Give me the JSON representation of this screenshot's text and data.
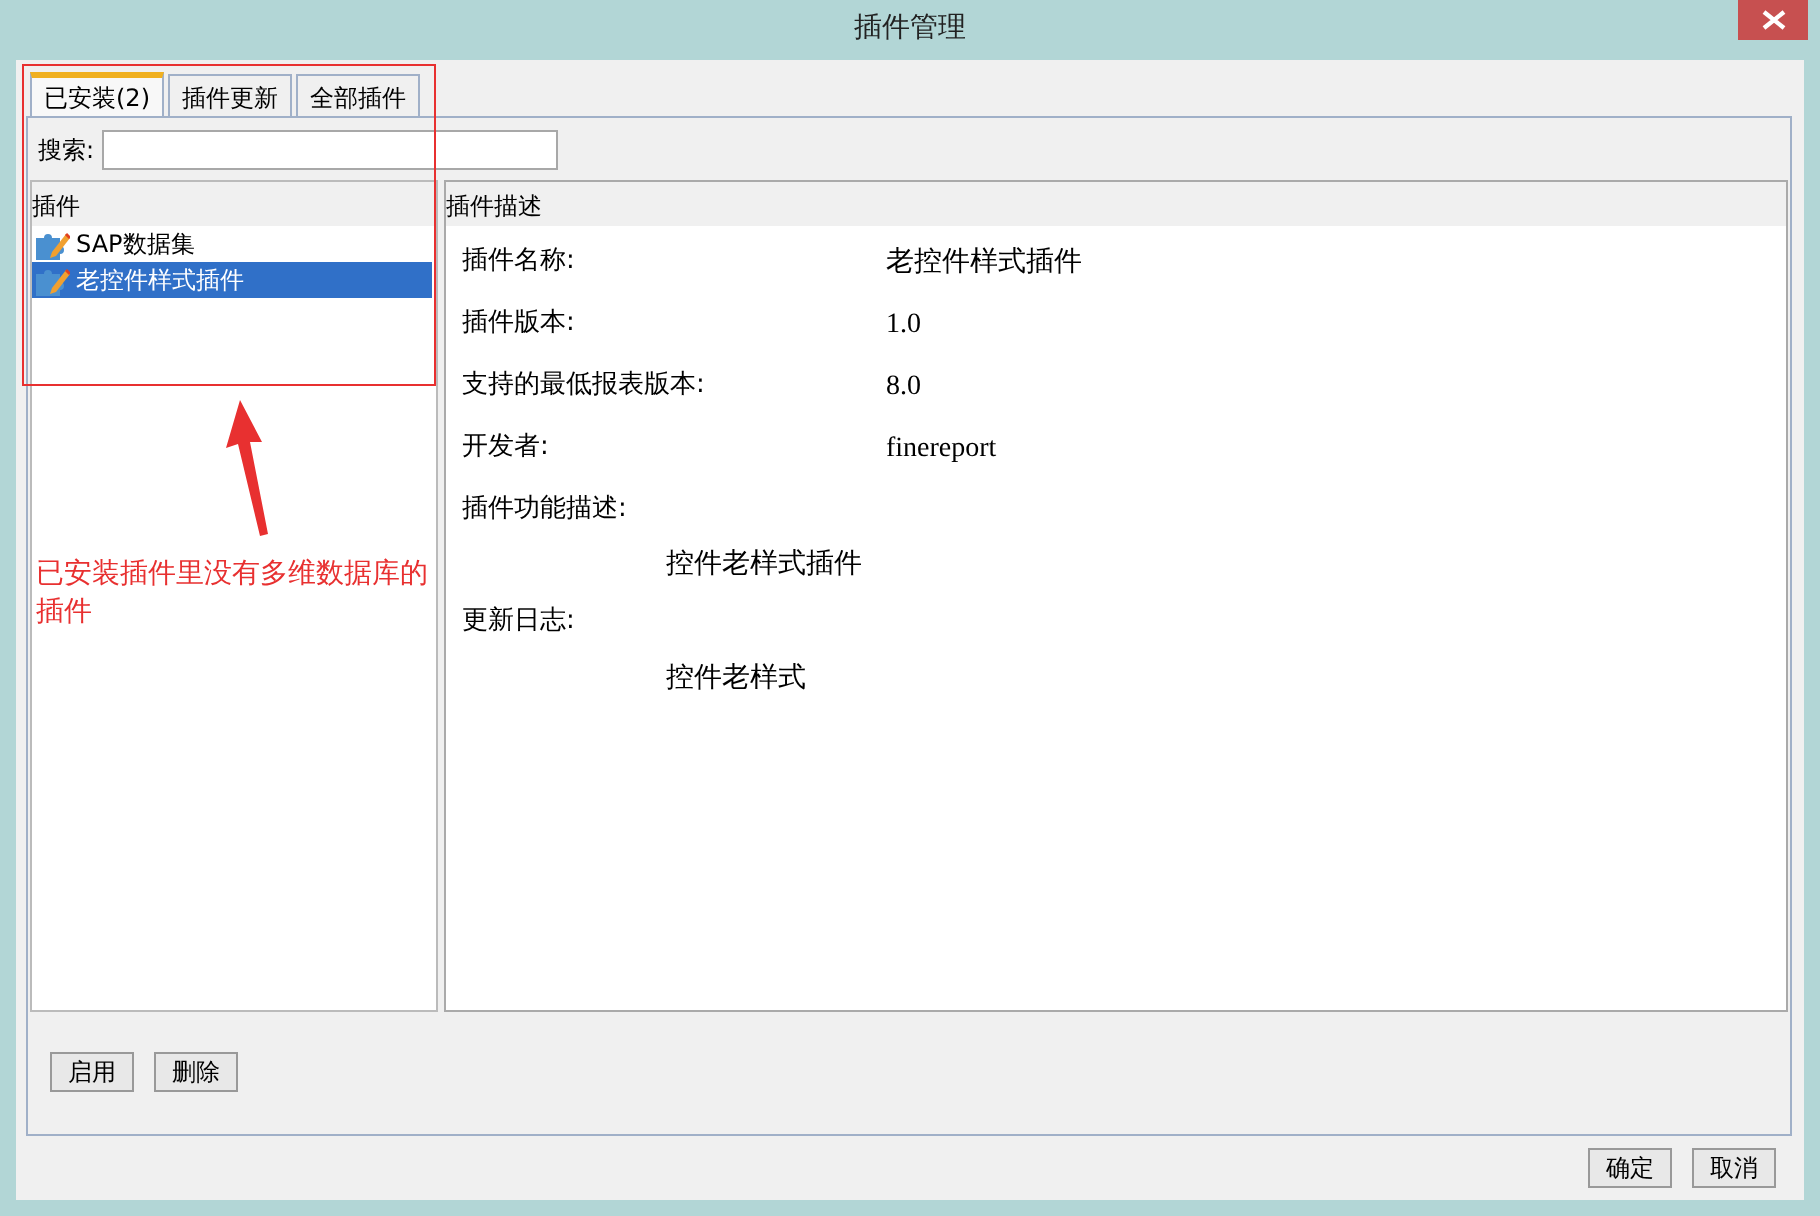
{
  "window": {
    "title": "插件管理"
  },
  "tabs": [
    {
      "label": "已安装(2)",
      "selected": true
    },
    {
      "label": "插件更新",
      "selected": false
    },
    {
      "label": "全部插件",
      "selected": false
    }
  ],
  "search": {
    "label": "搜索:"
  },
  "plugin_list": {
    "header": "插件",
    "items": [
      {
        "label": "SAP数据集",
        "selected": false
      },
      {
        "label": "老控件样式插件",
        "selected": true
      }
    ]
  },
  "description": {
    "header": "插件描述",
    "fields": [
      {
        "label": "插件名称:",
        "value": "老控件样式插件"
      },
      {
        "label": "插件版本:",
        "value": "1.0"
      },
      {
        "label": "支持的最低报表版本:",
        "value": "8.0"
      },
      {
        "label": "开发者:",
        "value": "finereport"
      }
    ],
    "sections": [
      {
        "label": "插件功能描述:",
        "value": "控件老样式插件"
      },
      {
        "label": "更新日志:",
        "value": "控件老样式"
      }
    ]
  },
  "panel_buttons": [
    "启用",
    "删除"
  ],
  "dialog_buttons": [
    "确定",
    "取消"
  ],
  "annotation": {
    "text": "已安装插件里没有多维数据库的插件"
  }
}
